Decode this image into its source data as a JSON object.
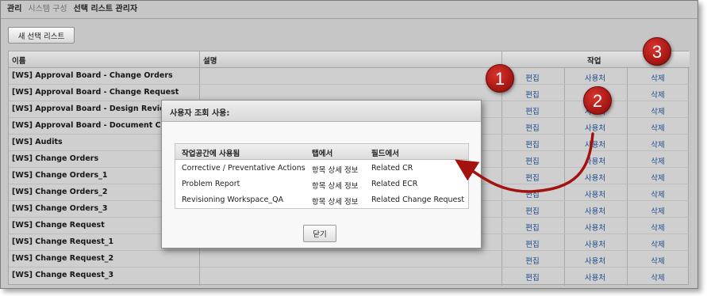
{
  "breadcrumb": {
    "root": "관리",
    "middle": "시스템 구성",
    "current": "선택 리스트 관리자"
  },
  "toolbar": {
    "new_list_label": "새 선택 리스트"
  },
  "grid": {
    "columns": {
      "name": "이름",
      "description": "설명",
      "actions": "작업"
    },
    "rows": [
      {
        "name": "[WS] Approval Board - Change Orders",
        "edit": "편집",
        "used_by": "사용처",
        "delete": "삭제"
      },
      {
        "name": "[WS] Approval Board - Change Request",
        "edit": "편집",
        "used_by": "사용처",
        "delete": "삭제"
      },
      {
        "name": "[WS] Approval Board - Design Review",
        "edit": "편집",
        "used_by": "사용처",
        "delete": "삭제"
      },
      {
        "name": "[WS] Approval Board - Document Change",
        "edit": "편집",
        "used_by": "사용처",
        "delete": "삭제"
      },
      {
        "name": "[WS] Audits",
        "edit": "편집",
        "used_by": "사용처",
        "delete": "삭제"
      },
      {
        "name": "[WS] Change Orders",
        "edit": "편집",
        "used_by": "사용처",
        "delete": "삭제"
      },
      {
        "name": "[WS] Change Orders_1",
        "edit": "편집",
        "used_by": "사용처",
        "delete": "삭제"
      },
      {
        "name": "[WS] Change Orders_2",
        "edit": "편집",
        "used_by": "사용처",
        "delete": "삭제"
      },
      {
        "name": "[WS] Change Orders_3",
        "edit": "편집",
        "used_by": "사용처",
        "delete": "삭제"
      },
      {
        "name": "[WS] Change Request",
        "edit": "편집",
        "used_by": "사용처",
        "delete": "삭제"
      },
      {
        "name": "[WS] Change Request_1",
        "edit": "편집",
        "used_by": "사용처",
        "delete": "삭제"
      },
      {
        "name": "[WS] Change Request_2",
        "edit": "편집",
        "used_by": "사용처",
        "delete": "삭제"
      },
      {
        "name": "[WS] Change Request_3",
        "edit": "편집",
        "used_by": "사용처",
        "delete": "삭제"
      }
    ]
  },
  "dialog": {
    "title": "사용자 조회 사용:",
    "columns": {
      "workspace": "작업공간에 사용됨",
      "tab": "탭에서",
      "field": "필드에서"
    },
    "rows": [
      {
        "workspace": "Corrective / Preventative Actions",
        "tab": "항목 상세 정보",
        "field": "Related CR"
      },
      {
        "workspace": "Problem Report",
        "tab": "항목 상세 정보",
        "field": "Related ECR"
      },
      {
        "workspace": "Revisioning Workspace_QA",
        "tab": "항목 상세 정보",
        "field": "Related Change Request"
      }
    ],
    "close_label": "닫기"
  },
  "callouts": {
    "one": "1",
    "two": "2",
    "three": "3"
  },
  "colors": {
    "callout": "#b01a14",
    "link": "#1d4b8c",
    "arrow": "#a3120e"
  }
}
